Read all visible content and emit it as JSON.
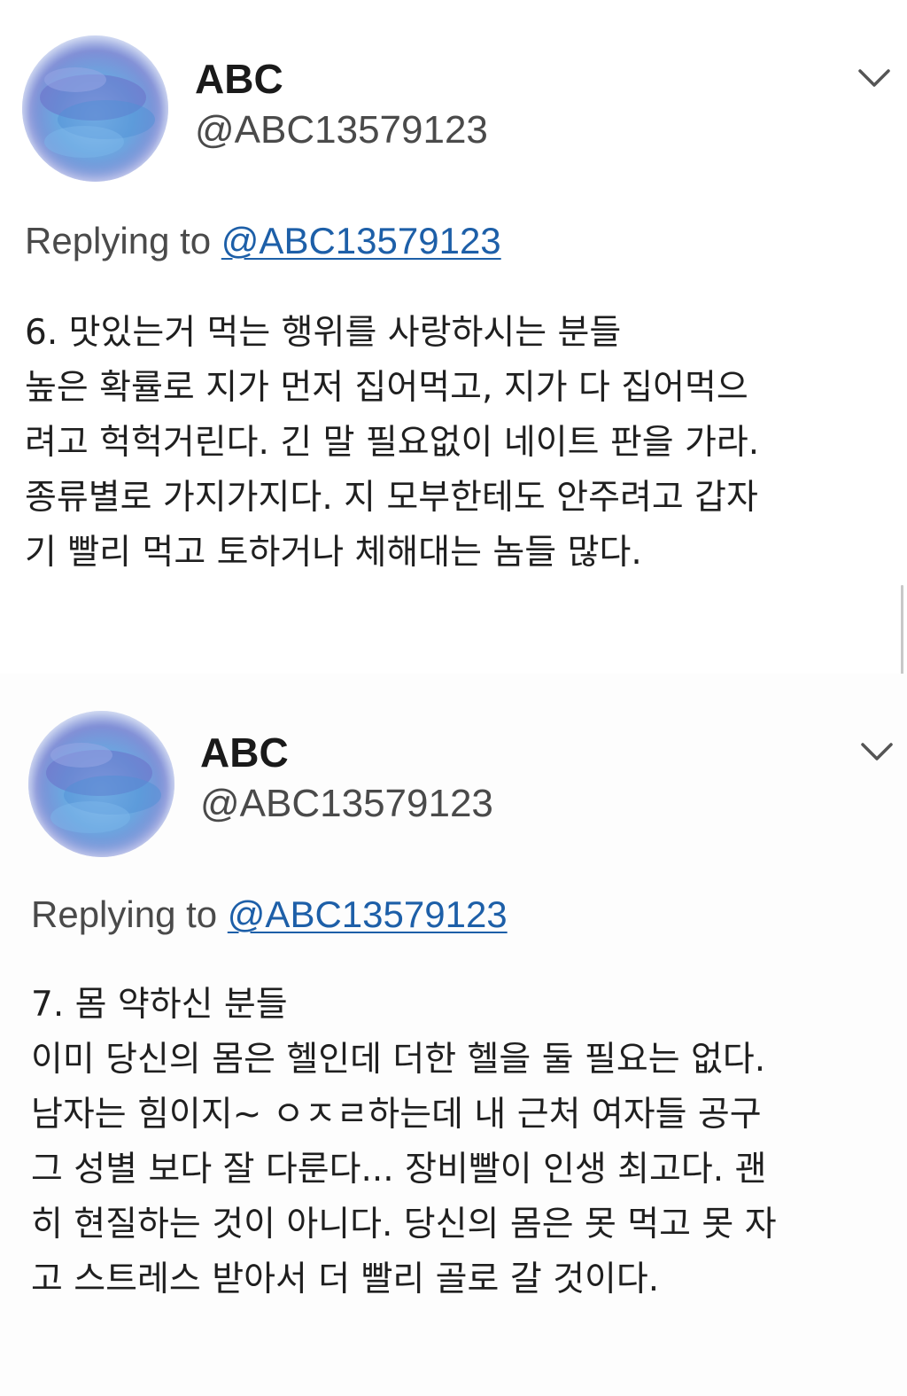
{
  "tweets": [
    {
      "display_name": "ABC",
      "handle": "@ABC13579123",
      "replying_prefix": "Replying to ",
      "replying_to": "@ABC13579123",
      "body_lines": [
        "6. 맛있는거 먹는 행위를 사랑하시는 분들",
        "높은 확률로 지가 먼저 집어먹고, 지가 다 집어먹으",
        "려고 헉헉거린다. 긴 말 필요없이 네이트 판을 가라.",
        "종류별로 가지가지다. 지 모부한테도 안주려고 갑자",
        "기 빨리 먹고 토하거나 체해대는 놈들 많다."
      ]
    },
    {
      "display_name": "ABC",
      "handle": "@ABC13579123",
      "replying_prefix": "Replying to ",
      "replying_to": "@ABC13579123",
      "body_lines": [
        "7. 몸 약하신 분들",
        "이미 당신의 몸은 헬인데 더한 헬을 둘 필요는 없다.",
        "남자는 힘이지~ ㅇㅈㄹ하는데 내 근처 여자들 공구",
        "그 성별 보다 잘 다룬다... 장비빨이 인생 최고다. 괜",
        "히 현질하는 것이 아니다. 당신의 몸은 못 먹고 못 자",
        "고 스트레스 받아서 더 빨리 골로 갈 것이다."
      ]
    }
  ],
  "icons": {
    "avatar": "watercolor-avatar-icon",
    "menu": "chevron-down-icon"
  },
  "colors": {
    "mention_link": "#1d5fa8",
    "secondary_text": "#4a4a4a",
    "primary_text": "#1f1f1f"
  }
}
